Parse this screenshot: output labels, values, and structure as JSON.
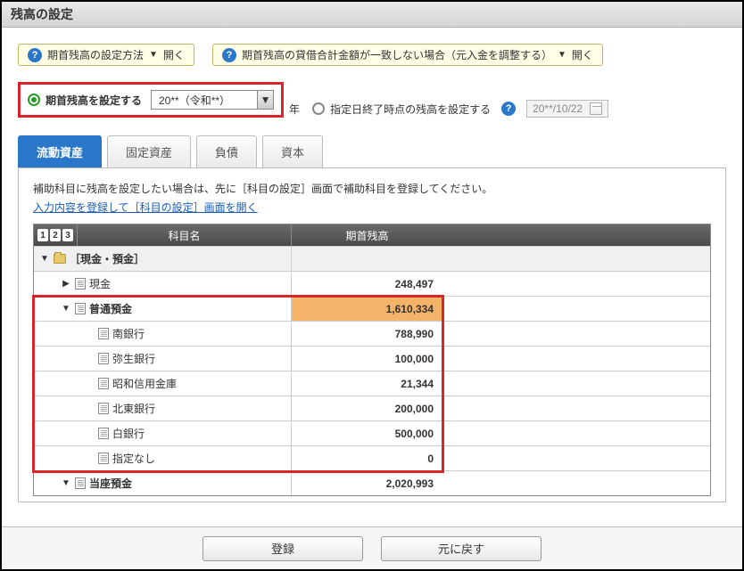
{
  "title": "残高の設定",
  "help": {
    "btn1": "期首残高の設定方法",
    "btn2": "期首残高の貸借合計金額が一致しない場合（元入金を調整する）",
    "open": "開く"
  },
  "options": {
    "opt1_label": "期首残高を設定する",
    "year_combo": "20**（令和**）",
    "year_suffix": "年",
    "opt2_label": "指定日終了時点の残高を設定する",
    "date_value": "20**/10/22"
  },
  "tabs": {
    "t1": "流動資産",
    "t2": "固定資産",
    "t3": "負債",
    "t4": "資本"
  },
  "hint_text": "補助科目に残高を設定したい場合は、先に［科目の設定］画面で補助科目を登録してください。",
  "link_text": "入力内容を登録して［科目の設定］画面を開く",
  "columns": {
    "name": "科目名",
    "val": "期首残高"
  },
  "rows": {
    "r0": {
      "label": "［現金・預金］",
      "val": ""
    },
    "r1": {
      "label": "現金",
      "val": "248,497"
    },
    "r2": {
      "label": "普通預金",
      "val": "1,610,334"
    },
    "r3": {
      "label": "南銀行",
      "val": "788,990"
    },
    "r4": {
      "label": "弥生銀行",
      "val": "100,000"
    },
    "r5": {
      "label": "昭和信用金庫",
      "val": "21,344"
    },
    "r6": {
      "label": "北東銀行",
      "val": "200,000"
    },
    "r7": {
      "label": "白銀行",
      "val": "500,000"
    },
    "r8": {
      "label": "指定なし",
      "val": "0"
    },
    "r9": {
      "label": "当座預金",
      "val": "2,020,993"
    }
  },
  "footer": {
    "submit": "登録",
    "reset": "元に戻す"
  }
}
